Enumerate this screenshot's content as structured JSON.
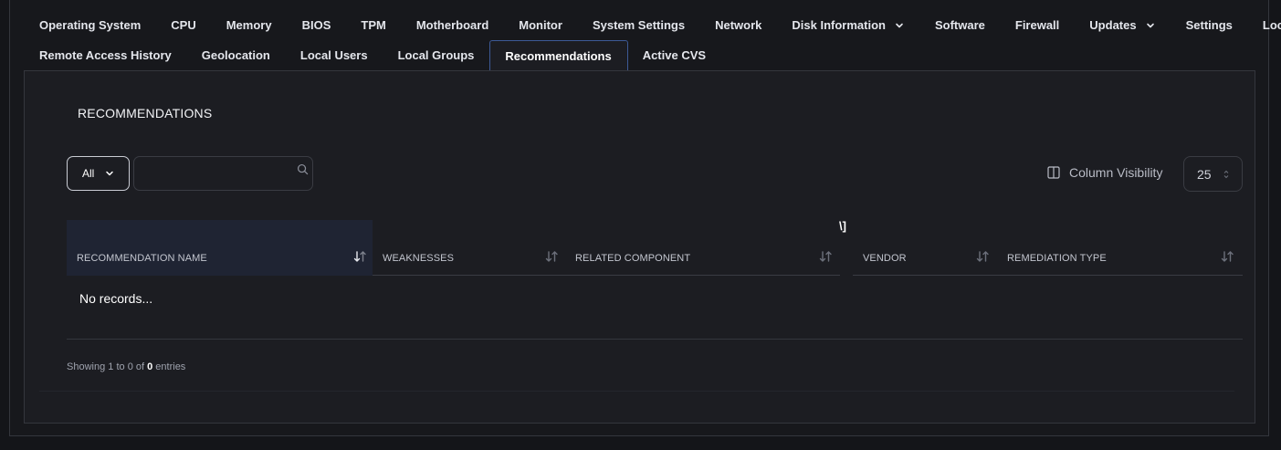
{
  "tabs_row1": [
    {
      "label": "Operating System",
      "dropdown": false
    },
    {
      "label": "CPU",
      "dropdown": false
    },
    {
      "label": "Memory",
      "dropdown": false
    },
    {
      "label": "BIOS",
      "dropdown": false
    },
    {
      "label": "TPM",
      "dropdown": false
    },
    {
      "label": "Motherboard",
      "dropdown": false
    },
    {
      "label": "Monitor",
      "dropdown": false
    },
    {
      "label": "System Settings",
      "dropdown": false
    },
    {
      "label": "Network",
      "dropdown": false
    },
    {
      "label": "Disk Information",
      "dropdown": true
    },
    {
      "label": "Software",
      "dropdown": false
    },
    {
      "label": "Firewall",
      "dropdown": false
    },
    {
      "label": "Updates",
      "dropdown": true
    },
    {
      "label": "Settings",
      "dropdown": false
    },
    {
      "label": "Location",
      "dropdown": false
    }
  ],
  "tabs_row2": [
    {
      "label": "Remote Access History",
      "active": false
    },
    {
      "label": "Geolocation",
      "active": false
    },
    {
      "label": "Local Users",
      "active": false
    },
    {
      "label": "Local Groups",
      "active": false
    },
    {
      "label": "Recommendations",
      "active": true
    },
    {
      "label": "Active CVS",
      "active": false
    }
  ],
  "section": {
    "title": "RECOMMENDATIONS"
  },
  "toolbar": {
    "filter_value": "All",
    "search_value": "",
    "column_visibility_label": "Column Visibility",
    "page_size": "25"
  },
  "stray_text": "\\]",
  "table": {
    "columns": [
      {
        "label": "RECOMMENDATION NAME",
        "sorted": true
      },
      {
        "label": "WEAKNESSES",
        "sorted": false
      },
      {
        "label": "RELATED COMPONENT",
        "sorted": false
      },
      {
        "label": "VENDOR",
        "sorted": false
      },
      {
        "label": "REMEDIATION TYPE",
        "sorted": false
      }
    ],
    "rows": [],
    "empty_text": "No records..."
  },
  "footer": {
    "prefix": "Showing ",
    "from": "1",
    "to_word": " to ",
    "to": "0",
    "of_word": " of ",
    "total": "0",
    "suffix": " entries"
  },
  "icons": {
    "chevron": "chevron-down-icon",
    "search": "search-icon",
    "column_visibility": "columns-icon",
    "sort": "sort-arrows-icon",
    "page_size_spinner": "up-down-icon"
  },
  "colors": {
    "active_tab_border": "#3d5a96",
    "sorted_header_bg": "#1f2433",
    "background": "#1c1d22"
  }
}
